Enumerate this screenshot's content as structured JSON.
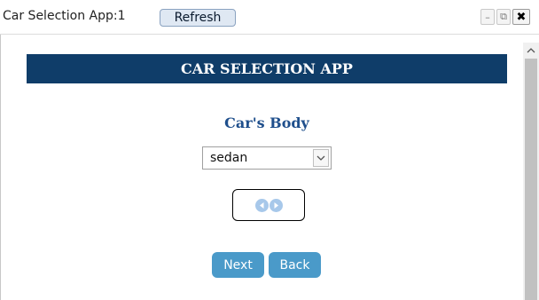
{
  "window": {
    "title": "Car Selection App:1",
    "refresh_label": "Refresh",
    "minimize_glyph": "–",
    "popout_glyph": "⧉",
    "close_glyph": "✖"
  },
  "app": {
    "header": "CAR SELECTION APP",
    "body_label": "Car's Body",
    "body_select": {
      "selected": "sedan"
    },
    "buttons": {
      "next": "Next",
      "back": "Back"
    }
  },
  "colors": {
    "header_bg": "#0f3d69",
    "label_color": "#1f4f8c",
    "button_bg": "#4a9ac9",
    "nav_circle": "#a7c8ea"
  },
  "icons": {
    "prev": "arrow-left-circle-icon",
    "next": "arrow-right-circle-icon",
    "dropdown": "chevron-down-icon",
    "scroll_up": "scroll-up-icon"
  }
}
